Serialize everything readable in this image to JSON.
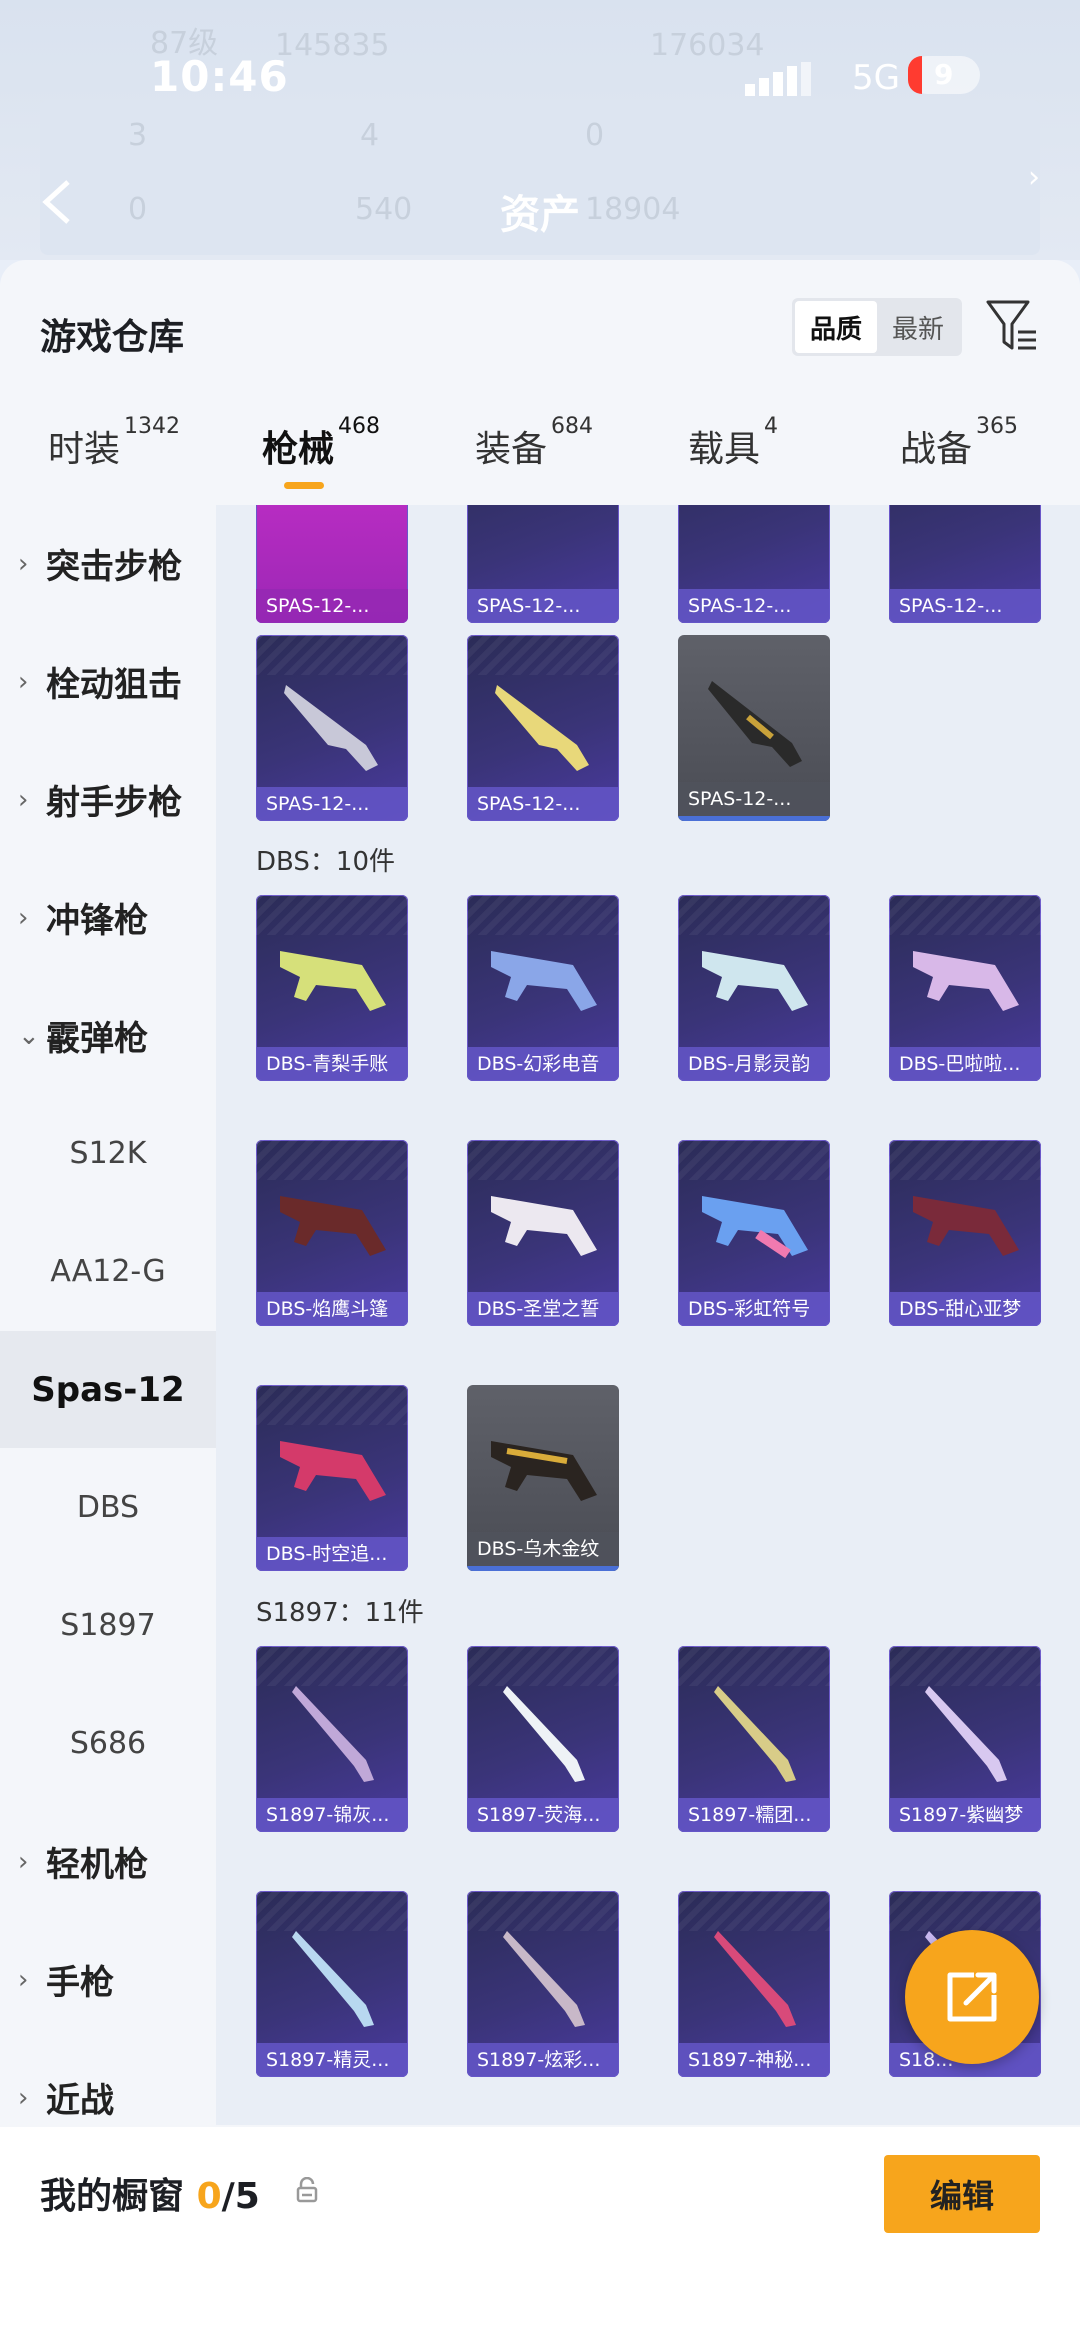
{
  "status": {
    "time": "10:46",
    "network": "5G",
    "battery": "9"
  },
  "background": {
    "level": "87级",
    "score1": "145835",
    "score2": "176034",
    "stats": [
      "3",
      "4",
      "0",
      "0",
      "540"
    ],
    "asset_label": "资产",
    "asset_value": "18904"
  },
  "sheet": {
    "title": "游戏仓库",
    "sort": [
      "品质",
      "最新"
    ]
  },
  "tabs": [
    {
      "label": "时装",
      "count": "1342"
    },
    {
      "label": "枪械",
      "count": "468"
    },
    {
      "label": "装备",
      "count": "684"
    },
    {
      "label": "载具",
      "count": "4"
    },
    {
      "label": "战备",
      "count": "365"
    }
  ],
  "sidebar": {
    "categories": [
      "突击步枪",
      "栓动狙击",
      "射手步枪",
      "冲锋枪",
      "霰弹枪"
    ],
    "subitems": [
      "S12K",
      "AA12-G",
      "Spas-12",
      "DBS",
      "S1897",
      "S686"
    ],
    "more": [
      "轻机枪",
      "手枪",
      "近战"
    ]
  },
  "grid": {
    "top_row": [
      "SPAS-12-...",
      "SPAS-12-...",
      "SPAS-12-...",
      "SPAS-12-..."
    ],
    "spas_row": [
      "SPAS-12-...",
      "SPAS-12-...",
      "SPAS-12-..."
    ],
    "dbs_title": "DBS：10件",
    "dbs_items": [
      "DBS-青梨手账",
      "DBS-幻彩电音",
      "DBS-月影灵韵",
      "DBS-巴啦啦...",
      "DBS-焰鹰斗篷",
      "DBS-圣堂之誓",
      "DBS-彩虹符号",
      "DBS-甜心亚梦",
      "DBS-时空追...",
      "DBS-乌木金纹"
    ],
    "s1897_title": "S1897：11件",
    "s1897_items": [
      "S1897-锦灰...",
      "S1897-荧海...",
      "S1897-糯团...",
      "S1897-紫幽梦",
      "S1897-精灵...",
      "S1897-炫彩...",
      "S1897-神秘...",
      "S18..."
    ]
  },
  "bottom": {
    "showcase_label": "我的橱窗",
    "count": "0",
    "total": "/5",
    "edit": "编辑"
  },
  "colors": {
    "accent": "#f7a51c",
    "card_purple": "#3a3478",
    "card_label": "#6456c8"
  }
}
